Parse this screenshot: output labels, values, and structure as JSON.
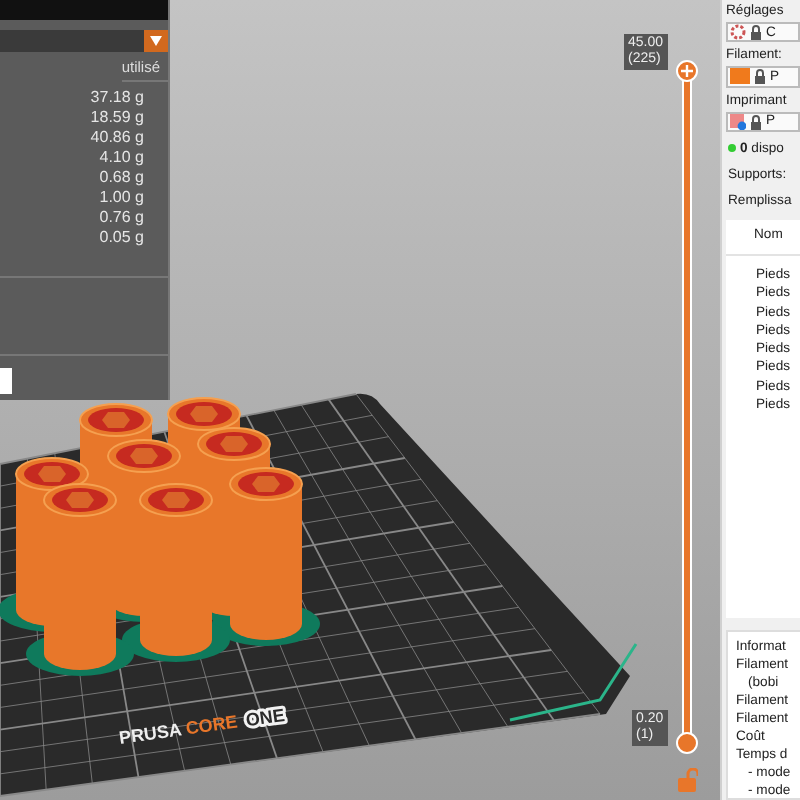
{
  "legend": {
    "header": "utilisé",
    "values": [
      "37.18 g",
      "18.59 g",
      "40.86 g",
      "4.10 g",
      "0.68 g",
      "1.00 g",
      "0.76 g",
      "0.05 g"
    ]
  },
  "viewport": {
    "bed_logo": [
      "PRUSA",
      "CORE",
      "ONE"
    ]
  },
  "layer_slider": {
    "top_value": "45.00",
    "top_layer": "(225)",
    "bottom_value": "0.20",
    "bottom_layer": "(1)",
    "level": 1,
    "locked": false
  },
  "sidebar": {
    "print_settings": {
      "label": "Réglages",
      "value": "C"
    },
    "filament": {
      "label": "Filament:",
      "color": "#f07a1c",
      "value": "P"
    },
    "printer": {
      "label": "Imprimant",
      "value": "P"
    },
    "status": {
      "text": "**0** dispo"
    },
    "supports": "Supports:",
    "infill": "Remplissa",
    "table": {
      "column": "Nom",
      "rows": [
        "Pieds",
        "Pieds",
        "Pieds",
        "Pieds",
        "Pieds",
        "Pieds",
        "Pieds",
        "Pieds"
      ]
    },
    "info": {
      "title": "Informat",
      "lines": [
        "Filament",
        "(bobi",
        "Filament",
        "Filament",
        "Coût",
        "Temps d",
        "- mode",
        "- mode"
      ]
    }
  }
}
